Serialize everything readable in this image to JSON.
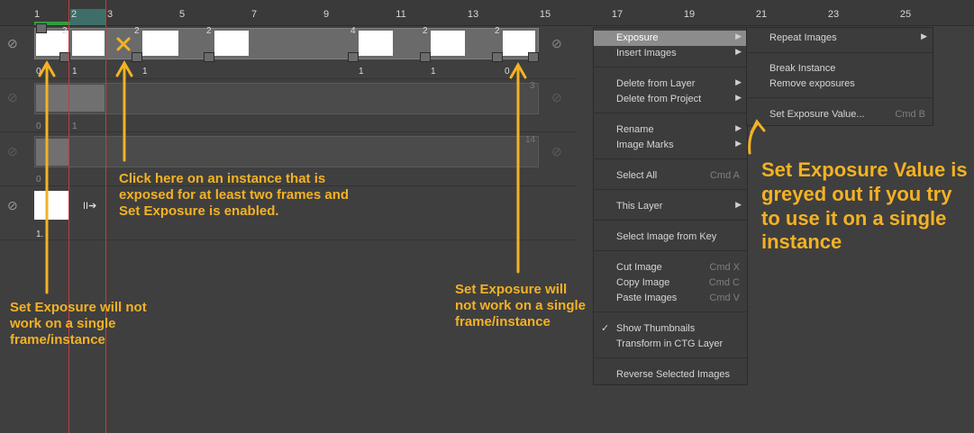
{
  "ruler": {
    "ticks": [
      "1",
      "2",
      "3",
      "5",
      "7",
      "9",
      "11",
      "13",
      "15",
      "17",
      "19",
      "21",
      "23",
      "25"
    ]
  },
  "tracks": {
    "layer1_numbers": [
      "0",
      "1",
      "1",
      "1",
      "1",
      "0"
    ],
    "layer1_tags": [
      "2",
      "2",
      "2",
      "4",
      "2",
      "2"
    ],
    "layer2_numbers": [
      "0",
      "1"
    ],
    "layer2_tag": "3",
    "layer3_number": "0",
    "layer3_tag": "14",
    "layer4_number": "1."
  },
  "context_menu": {
    "items": [
      {
        "label": "Exposure",
        "submenu": true
      },
      {
        "label": "Insert Images",
        "submenu": true
      },
      {
        "label": "Delete from Layer",
        "submenu": true
      },
      {
        "label": "Delete from Project",
        "submenu": true
      },
      {
        "label": "Rename",
        "submenu": true
      },
      {
        "label": "Image Marks",
        "submenu": true
      },
      {
        "label": "Select All",
        "shortcut": "Cmd A"
      },
      {
        "label": "This Layer",
        "submenu": true
      },
      {
        "label": "Select Image from Key"
      },
      {
        "label": "Cut Image",
        "shortcut": "Cmd X"
      },
      {
        "label": "Copy Image",
        "shortcut": "Cmd C"
      },
      {
        "label": "Paste Images",
        "shortcut": "Cmd V"
      },
      {
        "label": "Show Thumbnails",
        "checked": true
      },
      {
        "label": "Transform in CTG Layer"
      },
      {
        "label": "Reverse Selected Images"
      }
    ]
  },
  "submenu": {
    "items": [
      {
        "label": "Repeat Images",
        "submenu": true
      },
      {
        "label": "Break Instance"
      },
      {
        "label": "Remove exposures"
      },
      {
        "label": "Set Exposure Value...",
        "shortcut": "Cmd B"
      }
    ]
  },
  "annotations": {
    "left": "Set Exposure will not work on a single frame/instance",
    "middle": "Click here on an instance that is exposed for at least two frames and Set Exposure is enabled.",
    "right": "Set Exposure will not work on a single frame/instance",
    "big": "Set Exposure Value is greyed out if you try to use it on a single instance"
  },
  "colors": {
    "annotation": "#f3b224",
    "background": "#3f3f3f",
    "menu": "#3c3c3c",
    "highlight": "#8c8c8c",
    "playhead": "#c93a3a"
  }
}
